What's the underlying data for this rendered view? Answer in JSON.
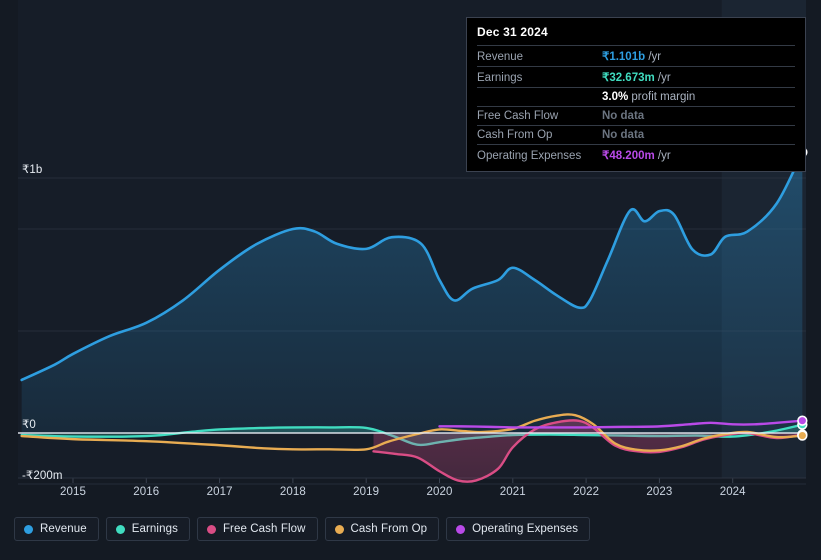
{
  "colors": {
    "background": "#141a23",
    "plot_background": "#161d28",
    "grid": "#2b3340",
    "zero_line": "#ffffff",
    "revenue": "#2e9ee0",
    "earnings": "#40dcc0",
    "free_cash_flow": "#d94d85",
    "cash_from_op": "#e8ac52",
    "operating_expenses": "#b94ae8",
    "tooltip_bg": "#000000",
    "tooltip_border": "#3b4250",
    "forecast_band": "#1b2535"
  },
  "tooltip": {
    "date": "Dec 31 2024",
    "rows": [
      {
        "label": "Revenue",
        "value": "₹1.101b",
        "unit": "/yr",
        "color": "#2e9ee0",
        "nodata": false
      },
      {
        "label": "Earnings",
        "value": "₹32.673m",
        "unit": "/yr",
        "color": "#40dcc0",
        "nodata": false
      },
      {
        "label": "",
        "value": "3.0%",
        "unit": "profit margin",
        "color": "#ffffff",
        "nodata": false,
        "sub": true
      },
      {
        "label": "Free Cash Flow",
        "value": "No data",
        "unit": "",
        "color": "#6b7480",
        "nodata": true
      },
      {
        "label": "Cash From Op",
        "value": "No data",
        "unit": "",
        "color": "#6b7480",
        "nodata": true
      },
      {
        "label": "Operating Expenses",
        "value": "₹48.200m",
        "unit": "/yr",
        "color": "#b94ae8",
        "nodata": false
      }
    ]
  },
  "legend": [
    {
      "label": "Revenue",
      "color": "#2e9ee0"
    },
    {
      "label": "Earnings",
      "color": "#40dcc0"
    },
    {
      "label": "Free Cash Flow",
      "color": "#d94d85"
    },
    {
      "label": "Cash From Op",
      "color": "#e8ac52"
    },
    {
      "label": "Operating Expenses",
      "color": "#b94ae8"
    }
  ],
  "chart_data": {
    "type": "area",
    "title": "",
    "xlabel": "",
    "ylabel": "",
    "currency": "₹",
    "grid": true,
    "legend_position": "bottom",
    "x_tick_labels": [
      "2015",
      "2016",
      "2017",
      "2018",
      "2019",
      "2020",
      "2021",
      "2022",
      "2023",
      "2024"
    ],
    "x_tick_values": [
      2015,
      2016,
      2017,
      2018,
      2019,
      2020,
      2021,
      2022,
      2023,
      2024
    ],
    "xlim": [
      2014.25,
      2025.0
    ],
    "y_tick_labels": [
      "₹1b",
      "₹0",
      "-₹200m"
    ],
    "y_tick_values": [
      1000000000,
      0,
      -200000000
    ],
    "ylim": [
      -260000000,
      1100000000
    ],
    "gridlines": [
      1000000000,
      800000000,
      400000000,
      -200000000
    ],
    "zero_line": 0,
    "forecast_band_start": 2023.85,
    "units": "absolute currency (INR)",
    "series": [
      {
        "name": "Revenue",
        "color": "#2e9ee0",
        "filled": true,
        "end_marker": true,
        "x": [
          2014.3,
          2014.75,
          2015.0,
          2015.5,
          2016.0,
          2016.5,
          2017.0,
          2017.5,
          2018.0,
          2018.3,
          2018.6,
          2019.0,
          2019.35,
          2019.75,
          2020.0,
          2020.2,
          2020.45,
          2020.8,
          2021.0,
          2021.3,
          2021.6,
          2021.9,
          2022.05,
          2022.3,
          2022.6,
          2022.8,
          2023.0,
          2023.2,
          2023.45,
          2023.7,
          2023.9,
          2024.2,
          2024.6,
          2024.95
        ],
        "y": [
          208000000,
          268000000,
          310000000,
          380000000,
          432000000,
          520000000,
          640000000,
          740000000,
          800000000,
          790000000,
          742000000,
          722000000,
          768000000,
          742000000,
          600000000,
          520000000,
          566000000,
          600000000,
          648000000,
          600000000,
          540000000,
          492000000,
          520000000,
          680000000,
          872000000,
          830000000,
          870000000,
          856000000,
          720000000,
          700000000,
          770000000,
          790000000,
          900000000,
          1101000000
        ]
      },
      {
        "name": "Earnings",
        "color": "#40dcc0",
        "filled": true,
        "end_marker": true,
        "x": [
          2014.3,
          2015.0,
          2016.0,
          2016.6,
          2017.0,
          2017.6,
          2018.0,
          2018.5,
          2019.0,
          2019.35,
          2019.7,
          2020.0,
          2020.3,
          2020.7,
          2021.0,
          2021.5,
          2022.0,
          2022.5,
          2023.0,
          2023.5,
          2024.0,
          2024.5,
          2024.95
        ],
        "y": [
          -8000000,
          -14000000,
          -12000000,
          4000000,
          14000000,
          20000000,
          22000000,
          22000000,
          20000000,
          -10000000,
          -46000000,
          -36000000,
          -24000000,
          -14000000,
          -8000000,
          -6000000,
          -8000000,
          -10000000,
          -12000000,
          -10000000,
          -14000000,
          4000000,
          32673000
        ]
      },
      {
        "name": "Free Cash Flow",
        "color": "#d94d85",
        "filled": true,
        "end_marker": true,
        "x": [
          2019.1,
          2019.4,
          2019.7,
          2020.0,
          2020.25,
          2020.5,
          2020.8,
          2021.0,
          2021.3,
          2021.6,
          2021.9,
          2022.1,
          2022.4,
          2022.7,
          2023.0,
          2023.3,
          2023.6,
          2023.9,
          2024.2,
          2024.6,
          2024.95
        ],
        "y": [
          -72000000,
          -82000000,
          -96000000,
          -150000000,
          -186000000,
          -186000000,
          -140000000,
          -56000000,
          14000000,
          42000000,
          48000000,
          20000000,
          -50000000,
          -72000000,
          -74000000,
          -56000000,
          -26000000,
          -8000000,
          0,
          -20000000,
          -6000000
        ]
      },
      {
        "name": "Cash From Op",
        "color": "#e8ac52",
        "filled": false,
        "end_marker": true,
        "x": [
          2014.3,
          2015.0,
          2016.0,
          2017.0,
          2017.6,
          2018.0,
          2018.5,
          2019.0,
          2019.3,
          2019.7,
          2020.0,
          2020.3,
          2020.6,
          2021.0,
          2021.3,
          2021.6,
          2021.85,
          2022.1,
          2022.4,
          2022.7,
          2023.0,
          2023.3,
          2023.6,
          2023.9,
          2024.2,
          2024.6,
          2024.95
        ],
        "y": [
          -12000000,
          -24000000,
          -32000000,
          -48000000,
          -60000000,
          -64000000,
          -64000000,
          -64000000,
          -34000000,
          -4000000,
          14000000,
          8000000,
          4000000,
          16000000,
          48000000,
          68000000,
          70000000,
          34000000,
          -42000000,
          -66000000,
          -68000000,
          -52000000,
          -22000000,
          -4000000,
          4000000,
          -16000000,
          -10000000
        ]
      },
      {
        "name": "Operating Expenses",
        "color": "#b94ae8",
        "filled": false,
        "end_marker": true,
        "x": [
          2020.0,
          2020.3,
          2020.7,
          2021.0,
          2021.5,
          2022.0,
          2022.5,
          2023.0,
          2023.4,
          2023.7,
          2024.0,
          2024.3,
          2024.6,
          2024.95
        ],
        "y": [
          26000000,
          26000000,
          24000000,
          22000000,
          22000000,
          22000000,
          24000000,
          26000000,
          34000000,
          40000000,
          34000000,
          34000000,
          40000000,
          48200000
        ]
      }
    ]
  }
}
